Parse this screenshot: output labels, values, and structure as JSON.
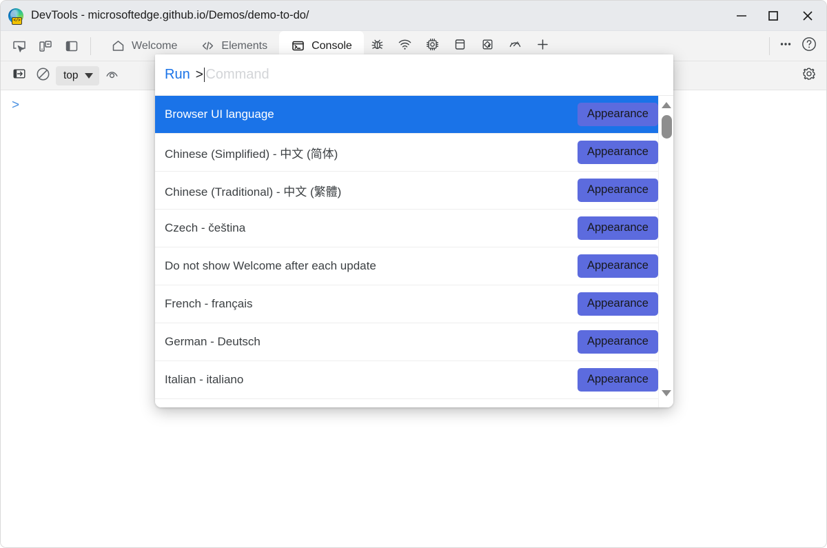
{
  "window": {
    "title": "DevTools - microsoftedge.github.io/Demos/demo-to-do/",
    "logo_icon": "edge-devtools-logo-icon",
    "controls": [
      {
        "name": "minimize-button",
        "icon": "minimize-icon",
        "label": "Minimize"
      },
      {
        "name": "maximize-button",
        "icon": "maximize-icon",
        "label": "Maximize"
      },
      {
        "name": "close-button",
        "icon": "close-icon",
        "label": "Close"
      }
    ]
  },
  "toolbar_left": [
    {
      "name": "inspect-element-button",
      "icon": "inspect-cursor-icon"
    },
    {
      "name": "device-emulation-button",
      "icon": "device-toolbar-icon"
    },
    {
      "name": "dock-side-button",
      "icon": "dock-panel-icon"
    }
  ],
  "tabs": [
    {
      "label": "Welcome",
      "icon": "home-icon",
      "active": false
    },
    {
      "label": "Elements",
      "icon": "code-brackets-icon",
      "active": false
    },
    {
      "label": "Console",
      "icon": "console-prompt-icon",
      "active": true
    }
  ],
  "tab_icon_buttons": [
    {
      "name": "tab-sources",
      "icon": "bug-icon"
    },
    {
      "name": "tab-network",
      "icon": "network-wifi-icon"
    },
    {
      "name": "tab-performance",
      "icon": "cpu-chip-icon"
    },
    {
      "name": "tab-application",
      "icon": "application-window-icon"
    },
    {
      "name": "tab-memory",
      "icon": "paint-bucket-icon"
    },
    {
      "name": "tab-lighthouse",
      "icon": "speedometer-icon"
    },
    {
      "name": "more-tabs-button",
      "icon": "plus-icon"
    }
  ],
  "tabstrip_right": [
    {
      "name": "customize-devtools-button",
      "icon": "more-horizontal-icon"
    },
    {
      "name": "help-button",
      "icon": "question-circle-icon"
    }
  ],
  "console_toolbar": {
    "sidebar_toggle": {
      "name": "console-sidebar-toggle",
      "icon": "sidebar-open-icon"
    },
    "clear_console": {
      "name": "clear-console-button",
      "icon": "no-entry-icon"
    },
    "context_selector": {
      "name": "javascript-context-selector",
      "value": "top",
      "icon": "chevron-down-icon"
    },
    "live_expression": {
      "name": "create-live-expression-button",
      "icon": "eye-icon"
    },
    "settings": {
      "name": "console-settings-button",
      "icon": "gear-icon"
    }
  },
  "console": {
    "prompt_symbol": ">",
    "prompt_icon": "chevron-right-icon"
  },
  "palette": {
    "run_label": "Run",
    "separator": ">",
    "placeholder": "Command",
    "input_value": "",
    "items": [
      {
        "title": "Browser UI language",
        "badge": "Appearance",
        "selected": true
      },
      {
        "title": "Chinese (Simplified) - 中文 (简体)",
        "badge": "Appearance",
        "selected": false
      },
      {
        "title": "Chinese (Traditional) - 中文 (繁體)",
        "badge": "Appearance",
        "selected": false
      },
      {
        "title": "Czech - čeština",
        "badge": "Appearance",
        "selected": false
      },
      {
        "title": "Do not show Welcome after each update",
        "badge": "Appearance",
        "selected": false
      },
      {
        "title": "French - français",
        "badge": "Appearance",
        "selected": false
      },
      {
        "title": "German - Deutsch",
        "badge": "Appearance",
        "selected": false
      },
      {
        "title": "Italian - italiano",
        "badge": "Appearance",
        "selected": false
      }
    ],
    "scrollbar": {
      "up_arrow_icon": "scroll-up-arrow-icon",
      "down_arrow_icon": "scroll-down-arrow-icon",
      "thumb": "scrollbar-thumb"
    }
  },
  "colors": {
    "selection_blue": "#1a73e8",
    "badge_indigo": "#5c6bde",
    "run_label_blue": "#1a73e8",
    "titlebar_gray": "#e8eaed",
    "toolbar_gray": "#f3f3f3"
  }
}
